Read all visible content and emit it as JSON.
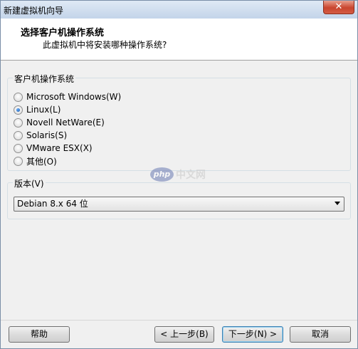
{
  "window": {
    "title": "新建虚拟机向导",
    "close_label": "✕"
  },
  "header": {
    "title": "选择客户机操作系统",
    "subtitle": "此虚拟机中将安装哪种操作系统?"
  },
  "os_group": {
    "label": "客户机操作系统",
    "options": [
      {
        "label": "Microsoft Windows(W)",
        "checked": false
      },
      {
        "label": "Linux(L)",
        "checked": true
      },
      {
        "label": "Novell NetWare(E)",
        "checked": false
      },
      {
        "label": "Solaris(S)",
        "checked": false
      },
      {
        "label": "VMware ESX(X)",
        "checked": false
      },
      {
        "label": "其他(O)",
        "checked": false
      }
    ]
  },
  "version_group": {
    "label": "版本(V)",
    "selected": "Debian 8.x 64 位"
  },
  "watermark": {
    "logo_text": "php",
    "text": "中文网"
  },
  "buttons": {
    "help": "帮助",
    "back": "< 上一步(B)",
    "next": "下一步(N) >",
    "cancel": "取消"
  }
}
